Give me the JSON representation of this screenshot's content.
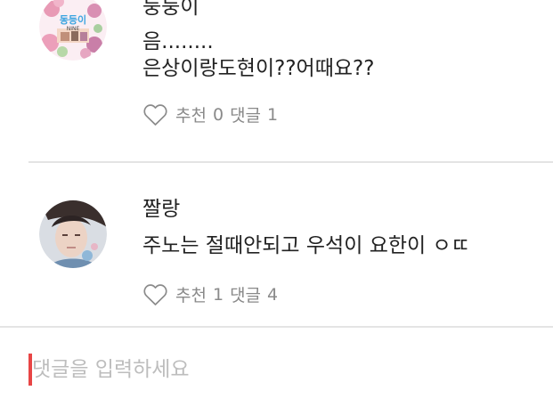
{
  "comments": [
    {
      "author": "둥둥이",
      "body_lines": [
        "음........",
        "은상이랑도현이??어때요??"
      ],
      "likes_label": "추천",
      "likes_count": "0",
      "replies_label": "댓글",
      "replies_count": "1",
      "avatar_badge_text": "동등이",
      "avatar_mini_text": "NINE"
    },
    {
      "author": "짤랑",
      "body_lines": [
        "주노는 절때안되고 우석이 요한이 ㅇㄸ"
      ],
      "likes_label": "추천",
      "likes_count": "1",
      "replies_label": "댓글",
      "replies_count": "4"
    }
  ],
  "comment_input": {
    "placeholder": "댓글을 입력하세요",
    "value": ""
  },
  "colors": {
    "cursor": "#e84545",
    "meta_text": "#8a8a8a",
    "divider": "#e4e4e4"
  },
  "icons": {
    "like": "heart-outline-icon"
  }
}
